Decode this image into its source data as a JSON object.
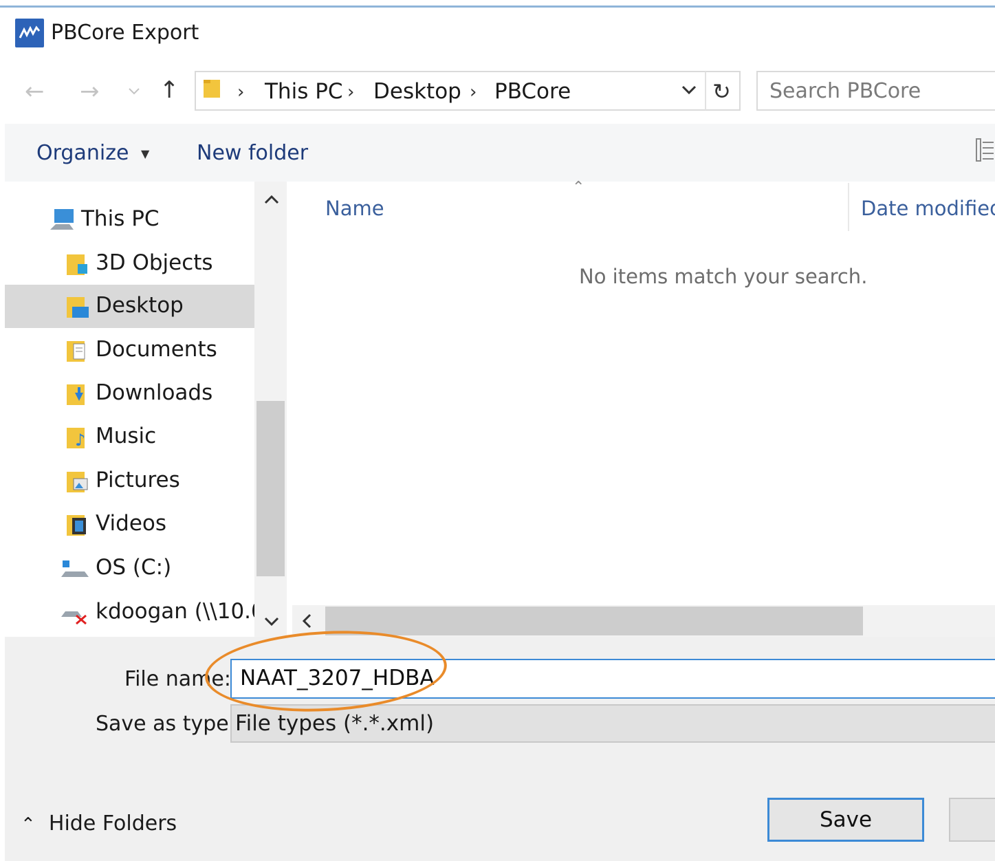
{
  "window": {
    "title": "PBCore Export"
  },
  "address_bar": {
    "breadcrumbs": [
      "This PC",
      "Desktop",
      "PBCore"
    ],
    "search_placeholder": "Search PBCore"
  },
  "command_bar": {
    "organize_label": "Organize",
    "new_folder_label": "New folder"
  },
  "nav_pane": {
    "root": "This PC",
    "items": [
      {
        "label": "3D Objects",
        "icon": "3d-objects-icon"
      },
      {
        "label": "Desktop",
        "icon": "desktop-folder-icon",
        "selected": true
      },
      {
        "label": "Documents",
        "icon": "documents-folder-icon"
      },
      {
        "label": "Downloads",
        "icon": "downloads-folder-icon"
      },
      {
        "label": "Music",
        "icon": "music-folder-icon"
      },
      {
        "label": "Pictures",
        "icon": "pictures-folder-icon"
      },
      {
        "label": "Videos",
        "icon": "videos-folder-icon"
      },
      {
        "label": "OS (C:)",
        "icon": "drive-icon"
      },
      {
        "label": "kdoogan (\\\\10.0",
        "icon": "disconnected-network-drive-icon"
      }
    ]
  },
  "file_list": {
    "columns": [
      "Name",
      "Date modified"
    ],
    "empty_message": "No items match your search."
  },
  "save_form": {
    "file_name_label": "File name:",
    "file_name_value": "NAAT_3207_HDBA",
    "save_as_type_label": "Save as type:",
    "save_as_type_value": "File types (*.*.xml)"
  },
  "footer": {
    "hide_folders_label": "Hide Folders",
    "save_label": "Save"
  },
  "colors": {
    "accent": "#3c8ad6",
    "highlight_annotation": "#e98b2a",
    "selected_nav": "#d9d9d9",
    "link_text": "#1e3b7a"
  }
}
